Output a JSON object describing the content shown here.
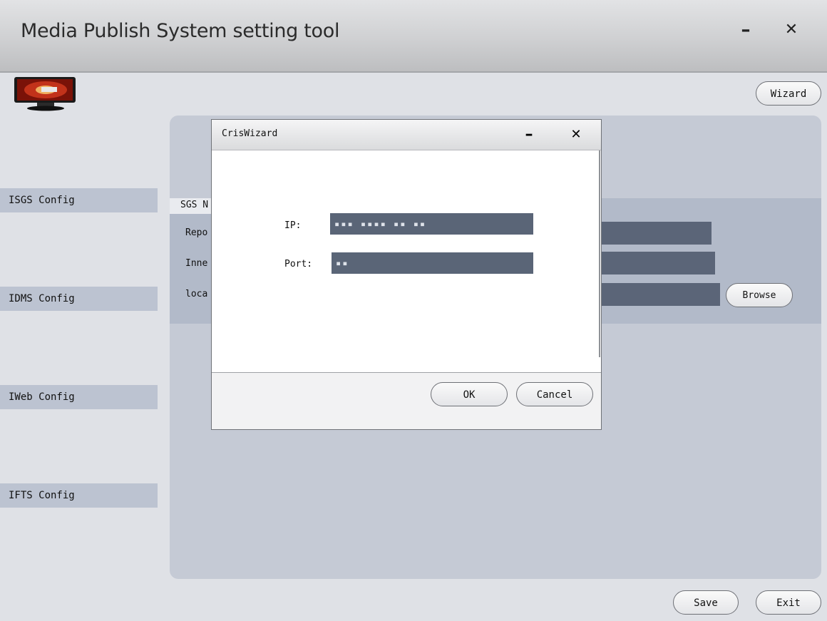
{
  "window": {
    "title": "Media Publish System setting tool",
    "minimize_glyph": "–",
    "close_glyph": "✕"
  },
  "toolbar": {
    "wizard_label": "Wizard"
  },
  "sidebar": {
    "items": [
      {
        "label": "ISGS Config"
      },
      {
        "label": "IDMS Config"
      },
      {
        "label": "IWeb Config"
      },
      {
        "label": "IFTS Config"
      }
    ]
  },
  "panel": {
    "sgs_label": "SGS N",
    "rows": [
      {
        "label": "Repo"
      },
      {
        "label": "Inne"
      },
      {
        "label": "loca"
      }
    ],
    "browse_label": "Browse"
  },
  "dialog": {
    "title": "CrisWizard",
    "minimize_glyph": "–",
    "close_glyph": "✕",
    "ip_label": "IP:",
    "ip_value": "▪▪▪ ▪▪▪▪ ▪▪ ▪▪",
    "port_label": "Port:",
    "port_value": "▪▪",
    "ok_label": "OK",
    "cancel_label": "Cancel"
  },
  "footer": {
    "save_label": "Save",
    "exit_label": "Exit"
  },
  "colors": {
    "sidebar_item_bg": "#bcc3d1",
    "panel_bg": "#c5cad5",
    "input_bg": "#5b6578"
  }
}
